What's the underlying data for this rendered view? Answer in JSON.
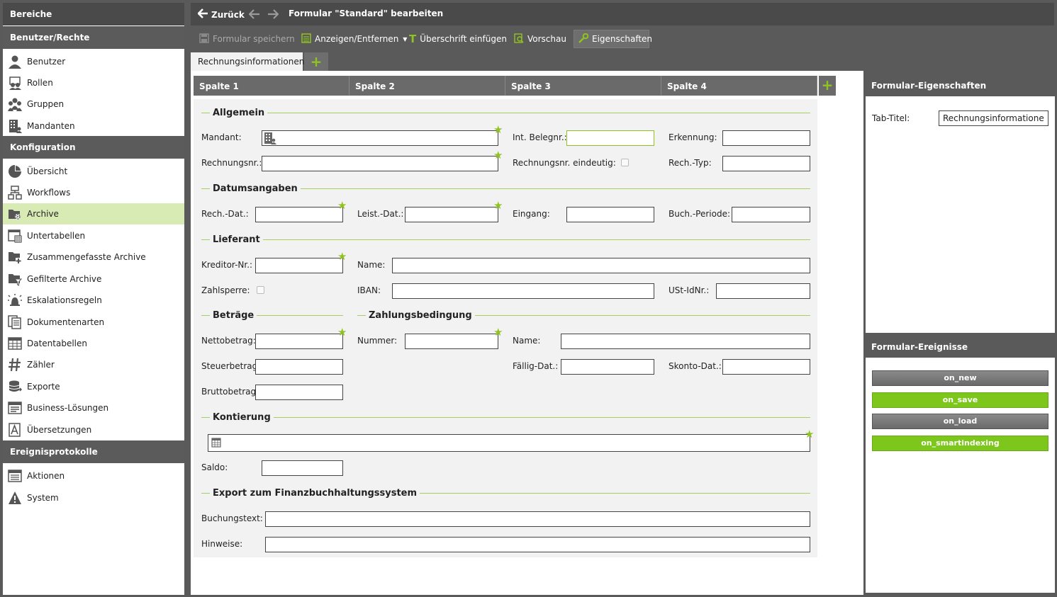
{
  "sidebar": {
    "header": "Bereiche",
    "groups": [
      {
        "title": "Benutzer/Rechte",
        "items": [
          {
            "label": "Benutzer",
            "icon": "user-icon"
          },
          {
            "label": "Rollen",
            "icon": "roles-icon"
          },
          {
            "label": "Gruppen",
            "icon": "group-icon"
          },
          {
            "label": "Mandanten",
            "icon": "building-icon"
          }
        ]
      },
      {
        "title": "Konfiguration",
        "items": [
          {
            "label": "Übersicht",
            "icon": "pie-chart-icon"
          },
          {
            "label": "Workflows",
            "icon": "workflow-icon"
          },
          {
            "label": "Archive",
            "icon": "archive-gear-icon",
            "active": true
          },
          {
            "label": "Untertabellen",
            "icon": "subtable-icon"
          },
          {
            "label": "Zusammengefasste Archive",
            "icon": "folder-plus-icon"
          },
          {
            "label": "Gefilterte Archive",
            "icon": "folder-filter-icon"
          },
          {
            "label": "Eskalationsregeln",
            "icon": "alarm-icon"
          },
          {
            "label": "Dokumentenarten",
            "icon": "documents-icon"
          },
          {
            "label": "Datentabellen",
            "icon": "grid-table-icon"
          },
          {
            "label": "Zähler",
            "icon": "hash-icon"
          },
          {
            "label": "Exporte",
            "icon": "database-export-icon"
          },
          {
            "label": "Business-Lösungen",
            "icon": "business-icon"
          },
          {
            "label": "Übersetzungen",
            "icon": "translate-icon"
          }
        ]
      },
      {
        "title": "Ereignisprotokolle",
        "items": [
          {
            "label": "Aktionen",
            "icon": "list-icon"
          },
          {
            "label": "System",
            "icon": "warning-icon"
          }
        ]
      }
    ]
  },
  "topbar": {
    "back_label": "Zurück",
    "title": "Formular \"Standard\" bearbeiten"
  },
  "toolbar": {
    "save": "Formular speichern",
    "show_hide": "Anzeigen/Entfernen",
    "insert_heading": "Überschrift einfügen",
    "preview": "Vorschau",
    "properties": "Eigenschaften"
  },
  "tabs": [
    "Rechnungsinformationen"
  ],
  "columns": [
    "Spalte 1",
    "Spalte 2",
    "Spalte 3",
    "Spalte 4"
  ],
  "form": {
    "sections": {
      "allgemein": "Allgemein",
      "datum": "Datumsangaben",
      "lieferant": "Lieferant",
      "betraege": "Beträge",
      "zahlung": "Zahlungsbedingung",
      "kontierung": "Kontierung",
      "export": "Export zum Finanzbuchhaltungssystem"
    },
    "labels": {
      "mandant": "Mandant:",
      "int_belegnr": "Int. Belegnr.:",
      "erkennung": "Erkennung:",
      "rechnungsnr": "Rechnungsnr.:",
      "rechnungsnr_eindeutig": "Rechnungsnr. eindeutig:",
      "rech_typ": "Rech.-Typ:",
      "rech_dat": "Rech.-Dat.:",
      "leist_dat": "Leist.-Dat.:",
      "eingang": "Eingang:",
      "buch_periode": "Buch.-Periode:",
      "kreditor_nr": "Kreditor-Nr.:",
      "name": "Name:",
      "zahlsperre": "Zahlsperre:",
      "iban": "IBAN:",
      "ust_idnr": "USt-IdNr.:",
      "nettobetrag": "Nettobetrag:",
      "nummer": "Nummer:",
      "name2": "Name:",
      "steuerbetrag": "Steuerbetrag:",
      "faellig_dat": "Fällig-Dat.:",
      "skonto_dat": "Skonto-Dat.:",
      "bruttobetrag": "Bruttobetrag:",
      "saldo": "Saldo:",
      "buchungstext": "Buchungstext:",
      "hinweise": "Hinweise:"
    }
  },
  "properties_panel": {
    "title": "Formular-Eigenschaften",
    "tab_title_label": "Tab-Titel:",
    "tab_title_value": "Rechnungsinformationen"
  },
  "events_panel": {
    "title": "Formular-Ereignisse",
    "events": [
      {
        "label": "on_new",
        "state": "gray"
      },
      {
        "label": "on_save",
        "state": "green"
      },
      {
        "label": "on_load",
        "state": "gray"
      },
      {
        "label": "on_smartindexing",
        "state": "green"
      }
    ]
  },
  "colors": {
    "accent": "#8fc31f",
    "active_bg": "#d8ebb5",
    "header_bg": "#5a5a5a"
  }
}
